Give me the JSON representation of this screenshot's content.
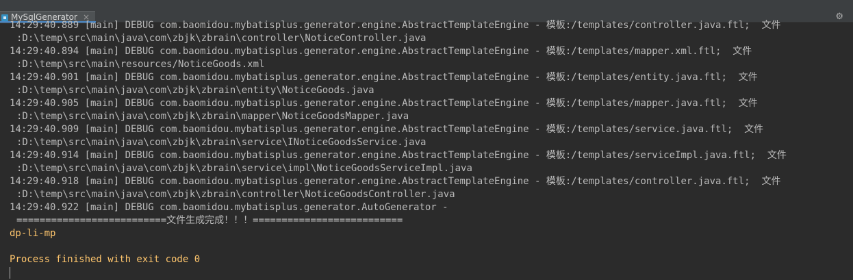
{
  "tab": {
    "title": "MySqlGenerator",
    "close_glyph": "×",
    "settings_glyph": "⚙"
  },
  "console": {
    "lines": [
      "14:29:40.889 [main] DEBUG com.baomidou.mybatisplus.generator.engine.AbstractTemplateEngine - 模板:/templates/controller.java.ftl;  文件",
      ":D:\\temp\\src\\main\\java\\com\\zbjk\\zbrain\\controller\\NoticeController.java",
      "14:29:40.894 [main] DEBUG com.baomidou.mybatisplus.generator.engine.AbstractTemplateEngine - 模板:/templates/mapper.xml.ftl;  文件",
      ":D:\\temp\\src\\main\\resources/NoticeGoods.xml",
      "14:29:40.901 [main] DEBUG com.baomidou.mybatisplus.generator.engine.AbstractTemplateEngine - 模板:/templates/entity.java.ftl;  文件",
      ":D:\\temp\\src\\main\\java\\com\\zbjk\\zbrain\\entity\\NoticeGoods.java",
      "14:29:40.905 [main] DEBUG com.baomidou.mybatisplus.generator.engine.AbstractTemplateEngine - 模板:/templates/mapper.java.ftl;  文件",
      ":D:\\temp\\src\\main\\java\\com\\zbjk\\zbrain\\mapper\\NoticeGoodsMapper.java",
      "14:29:40.909 [main] DEBUG com.baomidou.mybatisplus.generator.engine.AbstractTemplateEngine - 模板:/templates/service.java.ftl;  文件",
      ":D:\\temp\\src\\main\\java\\com\\zbjk\\zbrain\\service\\INoticeGoodsService.java",
      "14:29:40.914 [main] DEBUG com.baomidou.mybatisplus.generator.engine.AbstractTemplateEngine - 模板:/templates/serviceImpl.java.ftl;  文件",
      ":D:\\temp\\src\\main\\java\\com\\zbjk\\zbrain\\service\\impl\\NoticeGoodsServiceImpl.java",
      "14:29:40.918 [main] DEBUG com.baomidou.mybatisplus.generator.engine.AbstractTemplateEngine - 模板:/templates/controller.java.ftl;  文件",
      ":D:\\temp\\src\\main\\java\\com\\zbjk\\zbrain\\controller\\NoticeGoodsController.java",
      "14:29:40.922 [main] DEBUG com.baomidou.mybatisplus.generator.AutoGenerator -",
      "==========================文件生成完成！！！==========================",
      "dp-li-mp",
      "",
      "Process finished with exit code 0"
    ]
  },
  "colors": {
    "background": "#2b2b2b",
    "text": "#bbbbbb",
    "highlight": "#ffc66d"
  }
}
